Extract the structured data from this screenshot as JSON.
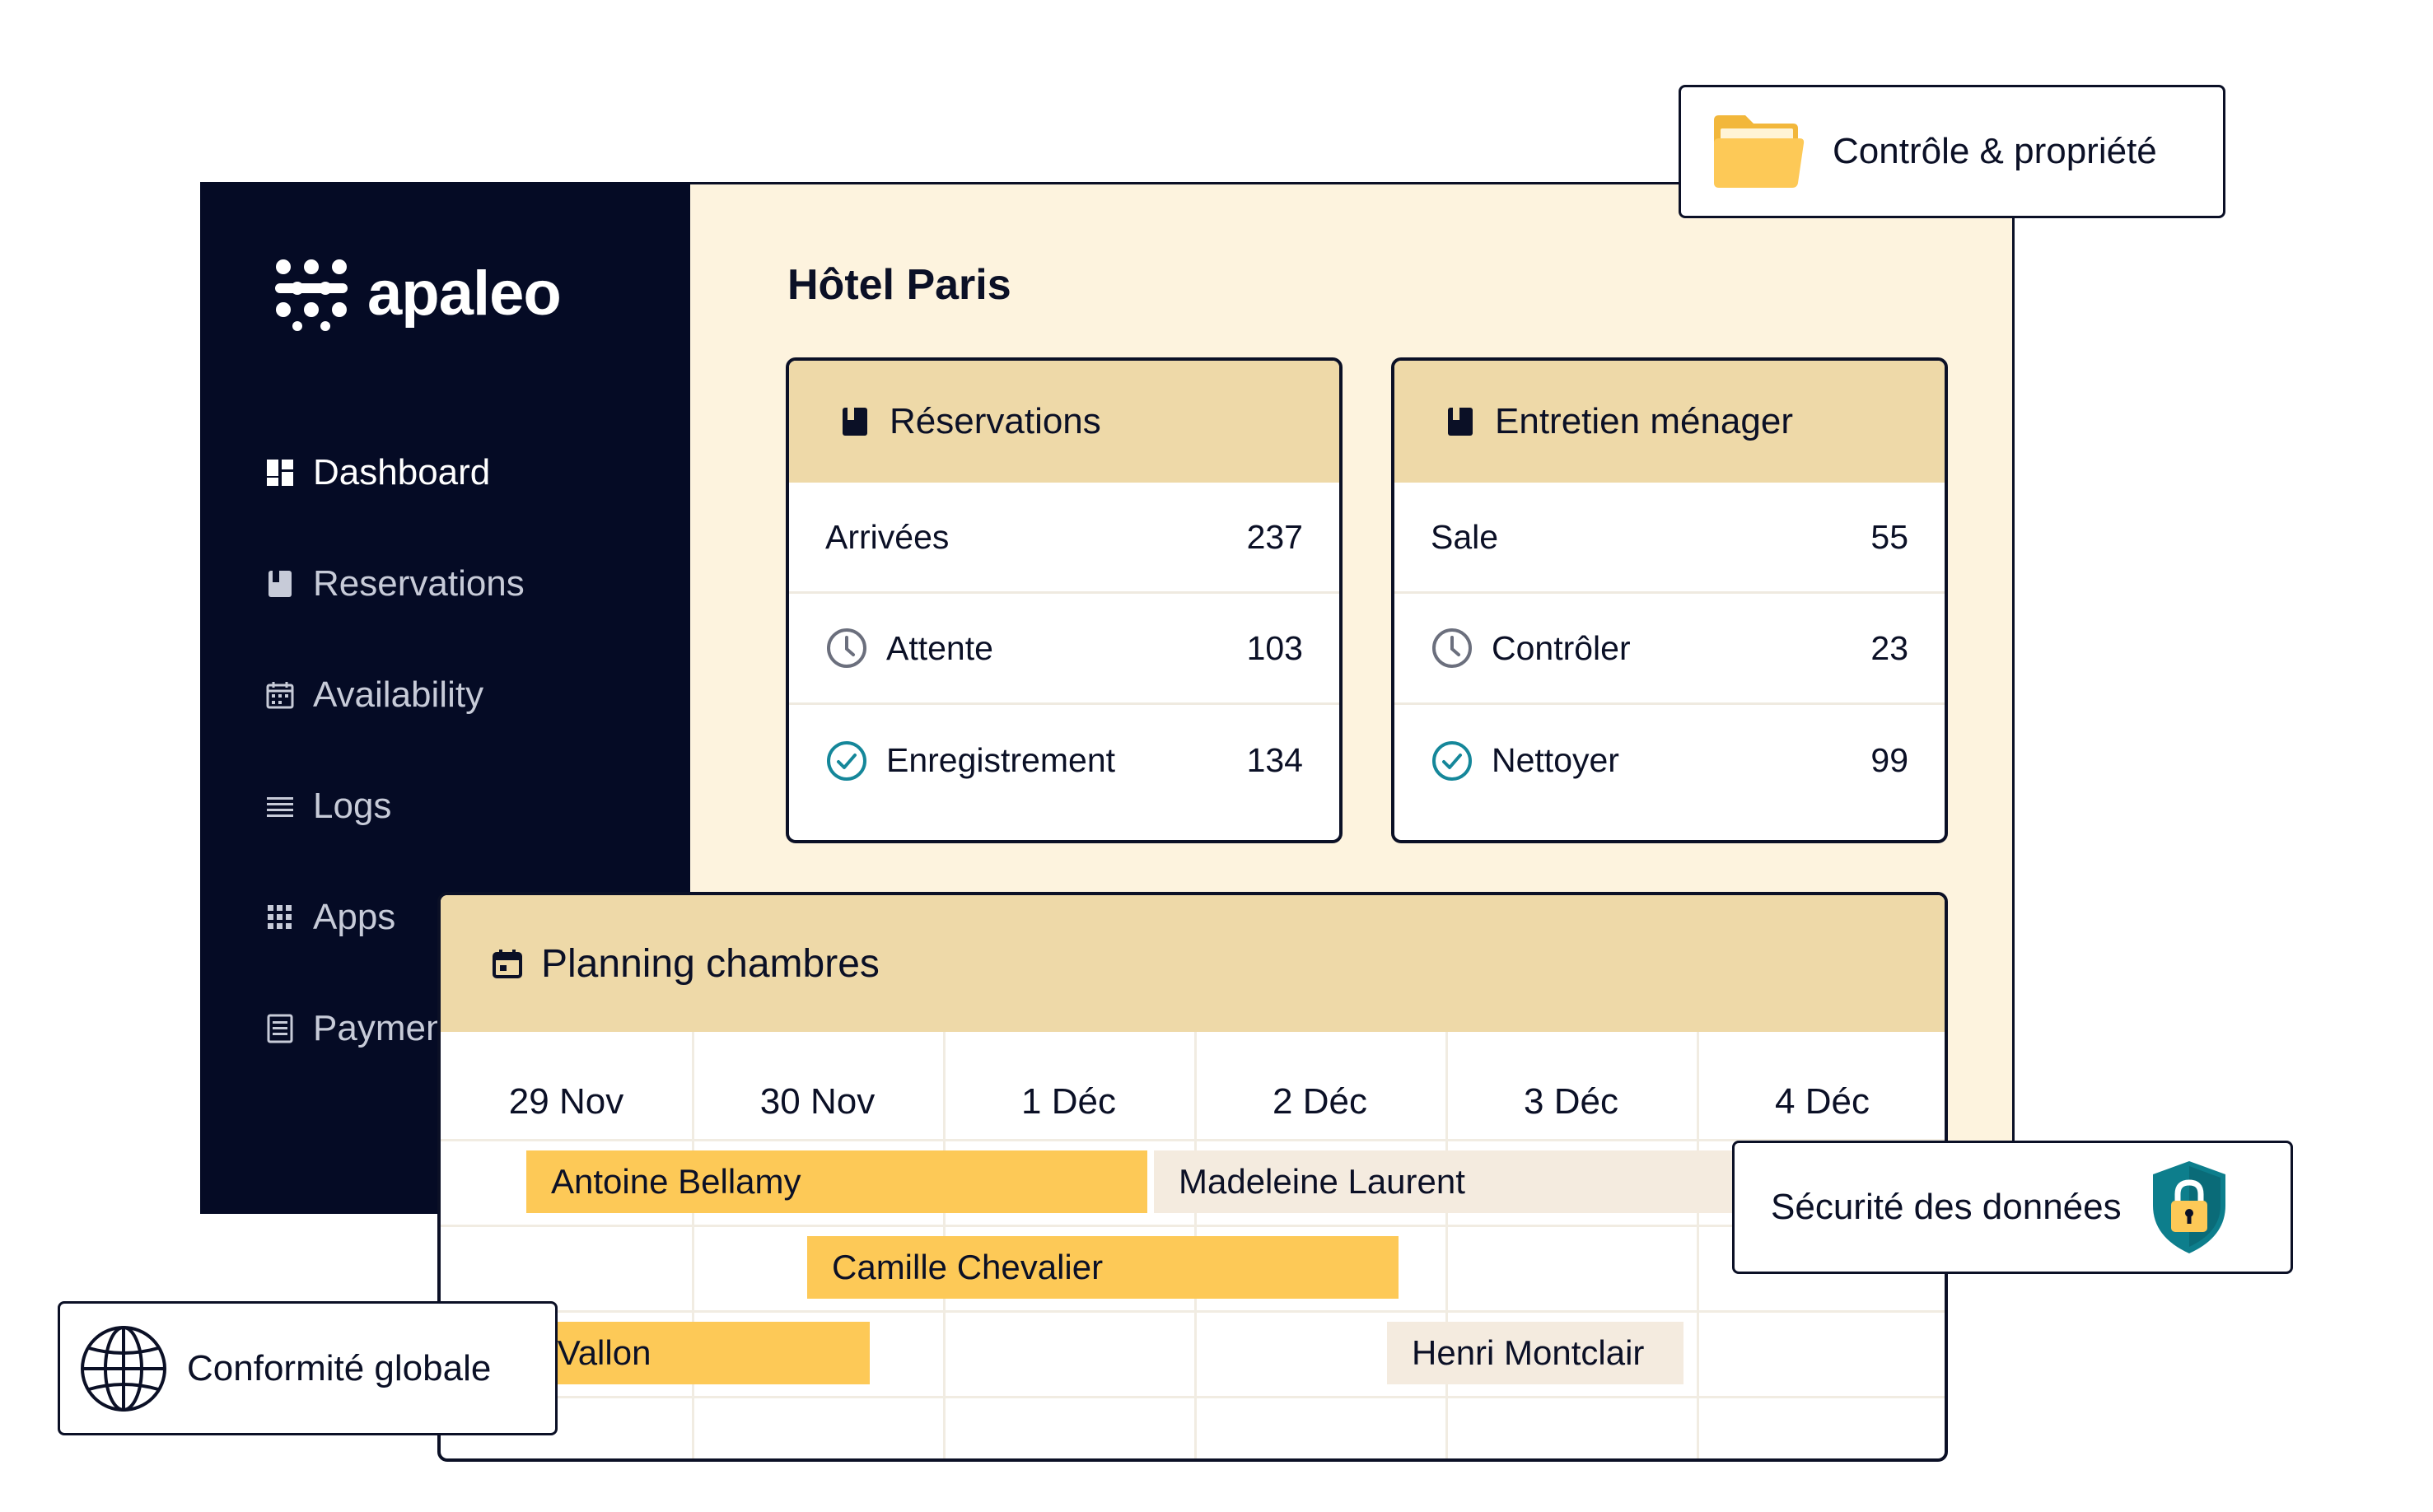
{
  "brand": {
    "name": "apaleo"
  },
  "sidebar": {
    "items": [
      {
        "label": "Dashboard",
        "icon": "dashboard-icon",
        "active": true
      },
      {
        "label": "Reservations",
        "icon": "book-icon"
      },
      {
        "label": "Availability",
        "icon": "calendar-icon"
      },
      {
        "label": "Logs",
        "icon": "list-icon"
      },
      {
        "label": "Apps",
        "icon": "grid-icon"
      },
      {
        "label": "Payments",
        "icon": "receipt-icon"
      }
    ]
  },
  "main": {
    "title": "Hôtel Paris",
    "cards": [
      {
        "title": "Réservations",
        "rows": [
          {
            "label": "Arrivées",
            "value": "237"
          },
          {
            "label": "Attente",
            "value": "103",
            "icon": "clock-icon"
          },
          {
            "label": "Enregistrement",
            "value": "134",
            "icon": "check-circle-icon"
          }
        ]
      },
      {
        "title": "Entretien ménager",
        "rows": [
          {
            "label": "Sale",
            "value": "55"
          },
          {
            "label": "Contrôler",
            "value": "23",
            "icon": "clock-icon"
          },
          {
            "label": "Nettoyer",
            "value": "99",
            "icon": "check-circle-icon"
          }
        ]
      }
    ],
    "planning": {
      "title": "Planning chambres",
      "days": [
        "29 Nov",
        "30 Nov",
        "1 Déc",
        "2 Déc",
        "3 Déc",
        "4 Déc"
      ],
      "bookings": [
        {
          "guest": "Antoine Bellamy",
          "style": "gold"
        },
        {
          "guest": "Madeleine Laurent",
          "style": "sand"
        },
        {
          "guest": "Camille Chevalier",
          "style": "gold"
        },
        {
          "guest": "Éléonore Vallon",
          "style": "gold"
        },
        {
          "guest": "Henri Montclair",
          "style": "sand"
        }
      ]
    }
  },
  "badges": {
    "control": "Contrôle & propriété",
    "security": "Sécurité des données",
    "compliance": "Conformité globale"
  },
  "colors": {
    "sidebar_bg": "#050b25",
    "canvas_bg": "#fdf3de",
    "header_bg": "#eed9a8",
    "booking_gold": "#fdc957",
    "booking_sand": "#f4ebdf",
    "check_teal": "#15879a",
    "shield_teal": "#0d7e8c",
    "folder_yellow": "#fdc957"
  }
}
